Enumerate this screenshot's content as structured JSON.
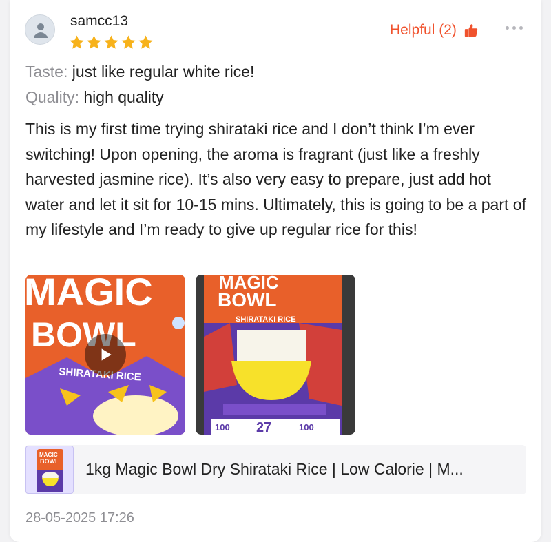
{
  "review": {
    "username": "samcc13",
    "rating": 5,
    "helpful_label": "Helpful (2)",
    "attributes": [
      {
        "key": "Taste:",
        "value": "just like regular white rice!"
      },
      {
        "key": "Quality:",
        "value": "high quality"
      }
    ],
    "text": "This is my first time trying shirataki rice and I don’t think I’m ever switching! Upon opening, the aroma is fragrant (just like a freshly harvested jasmine rice). It’s also very easy to prepare, just add hot water and let it sit for 10-15 mins. Ultimately, this is going to be a part of my lifestyle and I’m ready to give up regular rice for this!",
    "date": "28-05-2025 17:26"
  },
  "media": {
    "video": {
      "pack_title_1": "MAGIC",
      "pack_title_2": "BOWL",
      "pack_subtitle": "SHIRATAKI RICE"
    },
    "photo": {
      "pack_title_1": "MAGIC",
      "pack_title_2": "BOWL",
      "pack_subtitle": "SHIRATAKI RICE",
      "badge_left": "100",
      "badge_mid": "27",
      "badge_right": "100"
    }
  },
  "product": {
    "title": "1kg Magic Bowl Dry Shirataki Rice | Low Calorie | M...",
    "thumb_text_1": "MAGIC",
    "thumb_text_2": "BOWL"
  },
  "colors": {
    "helpful": "#f0522d",
    "star": "#f7b21b",
    "muted": "#8e8e93",
    "pack_orange": "#e8602a",
    "pack_purple": "#5b3aa8"
  }
}
